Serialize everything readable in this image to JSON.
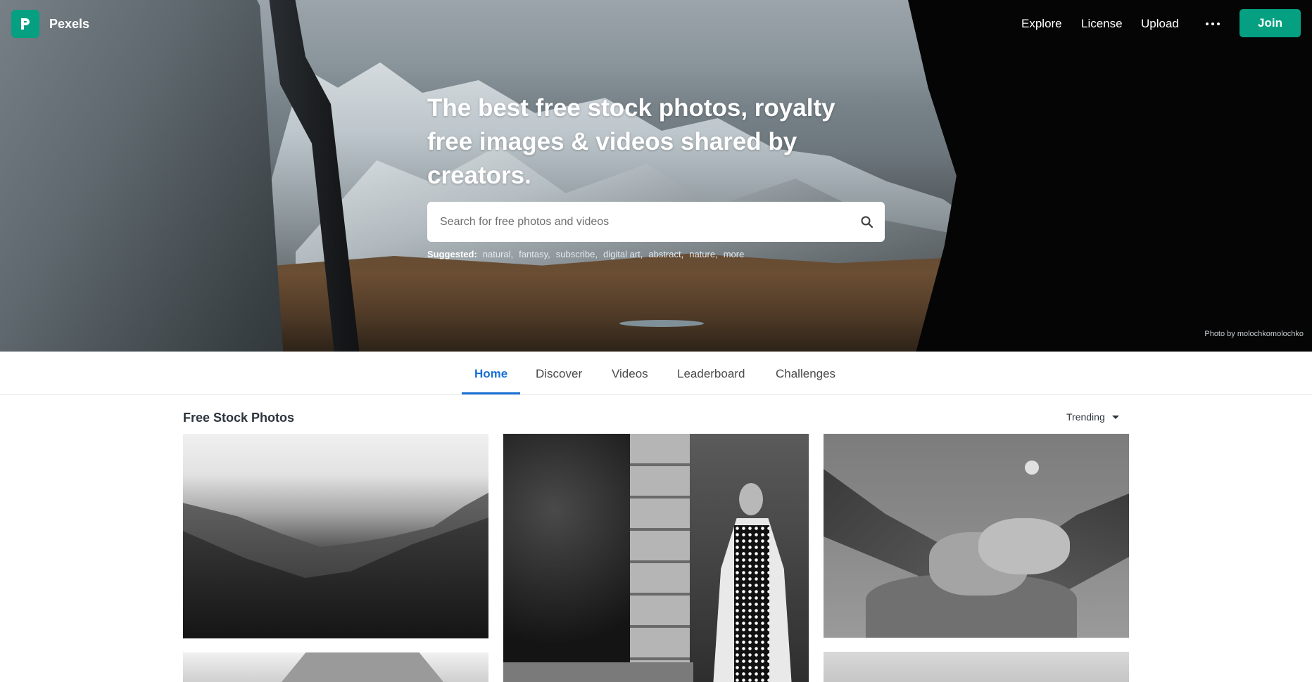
{
  "nav": {
    "brand": "Pexels",
    "links": [
      "Explore",
      "License",
      "Upload"
    ],
    "join_label": "Join"
  },
  "hero": {
    "headline": "The best free stock photos, royalty free images & videos shared by creators.",
    "search_placeholder": "Search for free photos and videos",
    "suggested_label": "Suggested:",
    "suggested_tags": [
      "natural,",
      "fantasy,",
      "subscribe,",
      "digital art,",
      "abstract,",
      "nature,",
      "more"
    ],
    "credit": "Photo by molochkomolochko"
  },
  "tabs": [
    "Home",
    "Discover",
    "Videos",
    "Leaderboard",
    "Challenges"
  ],
  "section": {
    "title": "Free Stock Photos",
    "sort_label": "Trending"
  },
  "colors": {
    "brand_green": "#05a081",
    "tab_active": "#1a70d6"
  }
}
